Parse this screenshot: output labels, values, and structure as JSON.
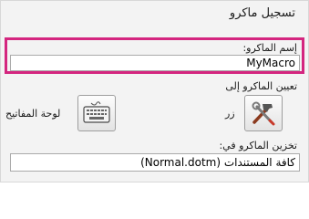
{
  "dialog": {
    "title": "تسجيل ماكرو",
    "macro_name_label": "إسم الماكرو:",
    "macro_name_value": "MyMacro",
    "assign_label": "تعيين الماكرو إلى",
    "button_option_label": "زر",
    "keyboard_option_label": "لوحة المفاتيح",
    "store_label": "تخزين الماكرو في:",
    "store_value": "كافة المستندات (Normal.dotm)"
  },
  "colors": {
    "highlight": "#d4267f",
    "dialog_bg": "#f3f3f3"
  },
  "icons": {
    "button": "hammer-wrench-icon",
    "keyboard": "keyboard-icon"
  }
}
